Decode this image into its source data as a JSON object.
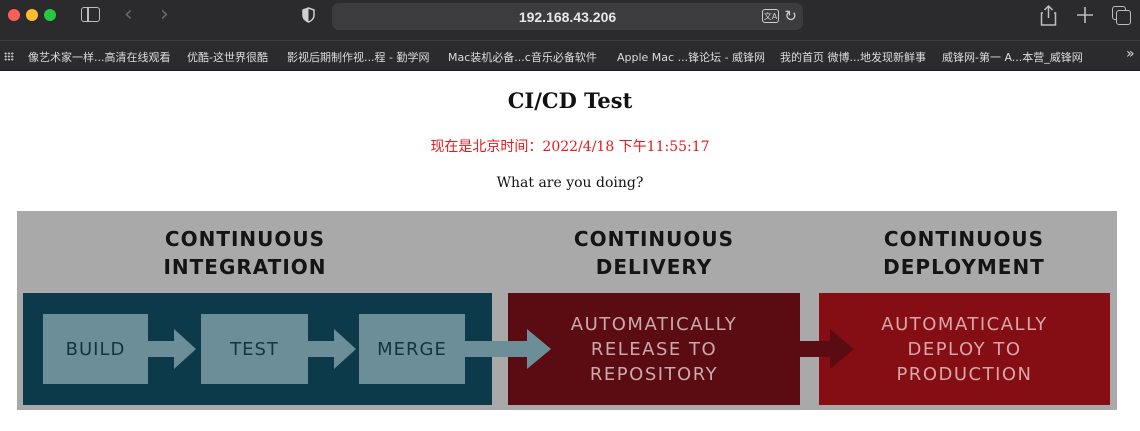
{
  "browser": {
    "url": "192.168.43.206",
    "bookmarks": [
      "像艺术家一样...高清在线观看",
      "优酷-这世界很酷",
      "影视后期制作视...程 - 勤学网",
      "Mac装机必备...c音乐必备软件",
      "Apple Mac ...锋论坛 - 威锋网",
      "我的首页 微博...地发现新鲜事",
      "威锋网-第一 A...本营_威锋网"
    ],
    "more_glyph": "»",
    "translate_glyph": "文A",
    "colors": {
      "chrome": "#2b2b2d",
      "urlbar": "#3c3c3e"
    }
  },
  "page": {
    "title": "CI/CD Test",
    "time_text": "现在是北京时间：2022/4/18 下午11:55:17",
    "question": "What are you doing?",
    "colors": {
      "time": "#e8181a"
    }
  },
  "diagram": {
    "headings": {
      "ci": [
        "CONTINUOUS",
        "INTEGRATION"
      ],
      "cd": [
        "CONTINUOUS",
        "DELIVERY"
      ],
      "cdp": [
        "CONTINUOUS",
        "DEPLOYMENT"
      ]
    },
    "steps": [
      "BUILD",
      "TEST",
      "MERGE"
    ],
    "delivery_text": [
      "AUTOMATICALLY",
      "RELEASE TO",
      "REPOSITORY"
    ],
    "deployment_text": [
      "AUTOMATICALLY",
      "DEPLOY TO",
      "PRODUCTION"
    ],
    "colors": {
      "ci_panel": "#0d3a4a",
      "cd_panel": "#5a0c12",
      "cdp_panel": "#840e14",
      "step_box": "#6c8e99",
      "background": "#a9a9a9"
    }
  }
}
